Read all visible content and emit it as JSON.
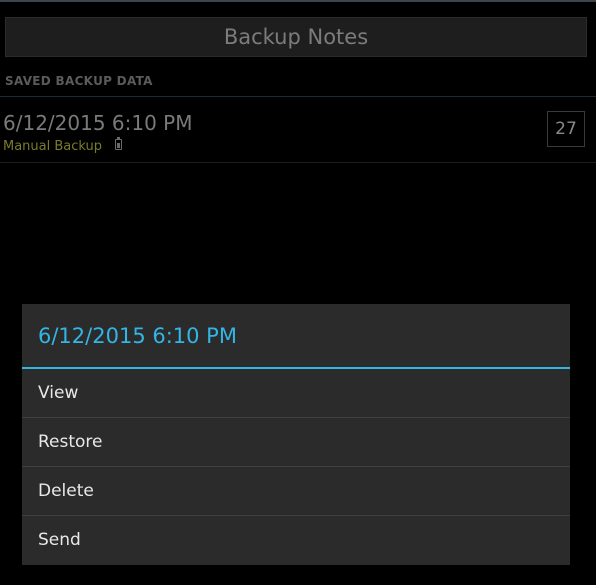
{
  "toolbar": {
    "backup_button_label": "Backup Notes"
  },
  "saved_section": {
    "header": "SAVED BACKUP DATA",
    "items": [
      {
        "date": "6/12/2015 6:10 PM",
        "type": "Manual Backup",
        "count": "27"
      }
    ]
  },
  "context_menu": {
    "title": "6/12/2015 6:10 PM",
    "items": [
      {
        "label": "View"
      },
      {
        "label": "Restore"
      },
      {
        "label": "Delete"
      },
      {
        "label": "Send"
      }
    ]
  },
  "colors": {
    "accent": "#33b5e5",
    "backup_type": "#7b7b2a",
    "background": "#000000",
    "dialog_bg": "#2b2b2b"
  },
  "icons": {
    "backup_type_icon": "battery-icon"
  }
}
